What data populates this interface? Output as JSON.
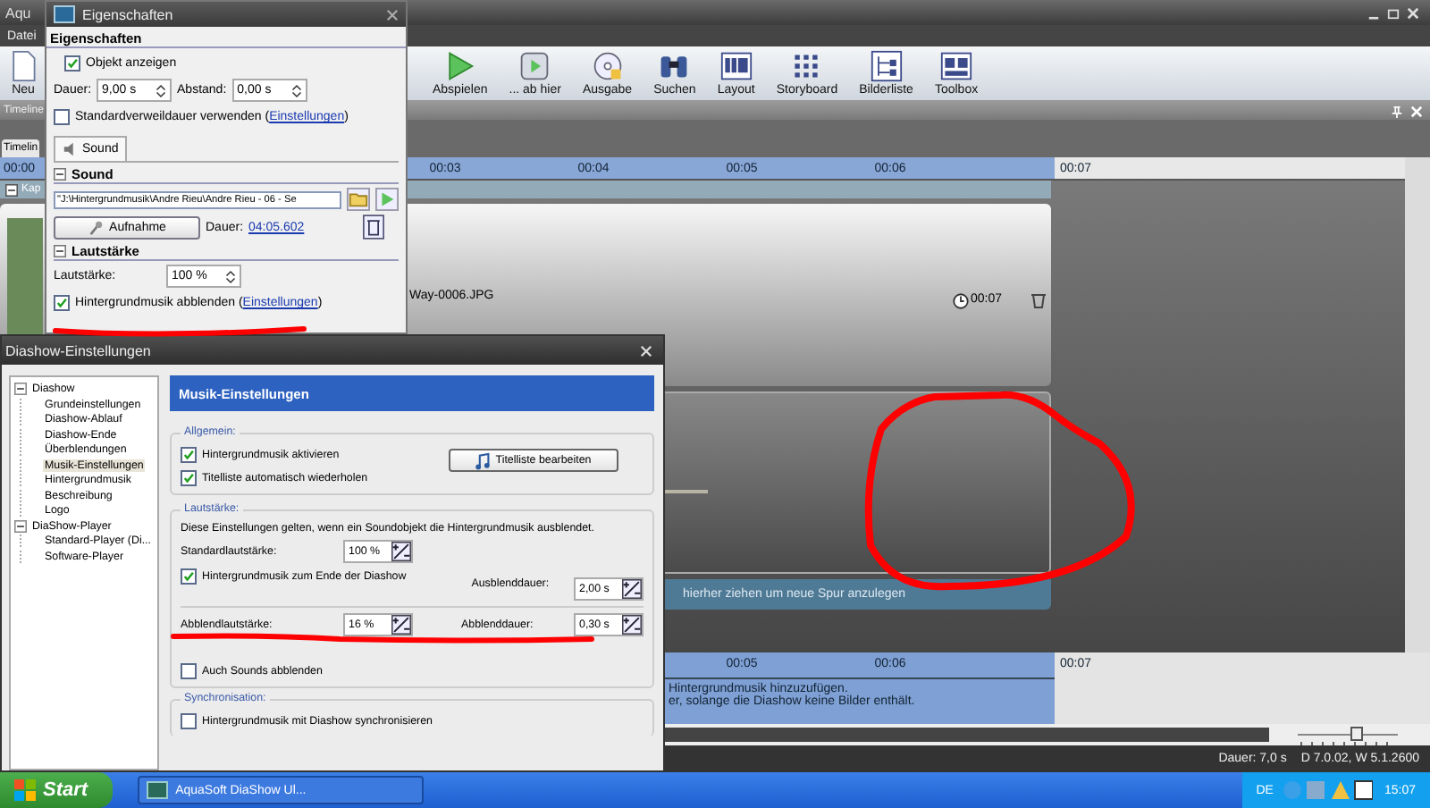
{
  "app_window": {
    "title": "Aqu",
    "menu": [
      "Datei"
    ]
  },
  "toolbar": [
    {
      "label": "Neu",
      "kind": "document"
    },
    {
      "label": "Abspielen",
      "kind": "play"
    },
    {
      "label": "... ab hier",
      "kind": "film"
    },
    {
      "label": "Ausgabe",
      "kind": "disc"
    },
    {
      "label": "Suchen",
      "kind": "binoculars"
    },
    {
      "label": "Layout",
      "kind": "layout"
    },
    {
      "label": "Storyboard",
      "kind": "grid"
    },
    {
      "label": "Bilderliste",
      "kind": "list"
    },
    {
      "label": "Toolbox",
      "kind": "toolbox"
    }
  ],
  "timeline_panel": {
    "title": "Timeline",
    "tab": "Timelin",
    "ruler": [
      "00:00",
      "00:03",
      "00:04",
      "00:05",
      "00:06",
      "00:07"
    ],
    "chapter": "Kap",
    "image_track": {
      "filename": "Way-0006.JPG",
      "duration": "00:07"
    },
    "drop_hint": "hierher ziehen um neue Spur anzulegen",
    "zoom_slider": {
      "level": 0.6
    }
  },
  "storyboard": {
    "ruler": [
      "00:05",
      "00:06",
      "00:07"
    ],
    "lines": [
      "Hintergrundmusik hinzuzufügen.",
      "er, solange die Diashow keine Bilder enthält."
    ]
  },
  "status_bar": [
    "Dauer: 7,0 s",
    "D 7.0.02, W 5.1.2600"
  ],
  "properties_window": {
    "title": "Eigenschaften",
    "heading": "Eigenschaften",
    "show_object": {
      "label": "Objekt anzeigen",
      "checked": true
    },
    "duration": {
      "label": "Dauer:",
      "value": "9,00 s"
    },
    "spacing": {
      "label": "Abstand:",
      "value": "0,00 s"
    },
    "default_duration": {
      "before": "Standardverweildauer verwenden (",
      "link": "Einstellungen",
      "after": ")",
      "checked": false
    },
    "tab": {
      "label": "Sound",
      "selected": true
    },
    "sound_group": {
      "title": "Sound",
      "file": "\"J:\\Hintergrundmusik\\Andre Rieu\\Andre Rieu - 06 - Se",
      "record": "Aufnahme",
      "duration_label": "Dauer:",
      "duration": "04:05.602"
    },
    "volume_group": {
      "title": "Lautstärke",
      "volume_label": "Lautstärke:",
      "volume": "100 %",
      "fade": {
        "before": "Hintergrundmusik abblenden (",
        "link": "Einstellungen",
        "after": ")",
        "checked": true
      }
    }
  },
  "settings_dialog": {
    "title": "Diashow-Einstellungen",
    "tree": [
      {
        "label": "Diashow",
        "expanded": true,
        "selected": false,
        "children": [
          {
            "label": "Grundeinstellungen",
            "selected": false
          },
          {
            "label": "Diashow-Ablauf",
            "selected": false
          },
          {
            "label": "Diashow-Ende",
            "selected": false
          },
          {
            "label": "Überblendungen",
            "selected": false
          },
          {
            "label": "Musik-Einstellungen",
            "selected": true
          },
          {
            "label": "Hintergrundmusik",
            "selected": false
          },
          {
            "label": "Beschreibung",
            "selected": false
          },
          {
            "label": "Logo",
            "selected": false
          }
        ]
      },
      {
        "label": "DiaShow-Player",
        "expanded": true,
        "selected": false,
        "children": [
          {
            "label": "Standard-Player (Di...",
            "selected": false
          },
          {
            "label": "Software-Player",
            "selected": false
          }
        ]
      }
    ],
    "header": "Musik-Einstellungen",
    "general": {
      "title": "Allgemein:",
      "options": [
        {
          "label": "Hintergrundmusik aktivieren",
          "checked": true
        },
        {
          "label": "Titelliste automatisch wiederholen",
          "checked": true
        }
      ],
      "button": "Titelliste bearbeiten"
    },
    "volume": {
      "title": "Lautstärke:",
      "description": "Diese Einstellungen gelten, wenn ein Soundobjekt die Hintergrundmusik ausblendet.",
      "standard_label": "Standardlautstärke:",
      "standard": "100 %",
      "fade_end": {
        "label": "Hintergrundmusik zum Ende der Diashow",
        "checked": true
      },
      "fadeout_label": "Ausblenddauer:",
      "fadeout": "2,00 s",
      "dim_label": "Abblendlautstärke:",
      "dim": "16 %",
      "dim_time_label": "Abblenddauer:",
      "dim_time": "0,30 s",
      "sounds": {
        "label": "Auch Sounds abblenden",
        "checked": false
      }
    },
    "sync": {
      "title": "Synchronisation:",
      "option": {
        "label": "Hintergrundmusik mit Diashow synchronisieren",
        "checked": false
      }
    }
  },
  "taskbar": {
    "start": "Start",
    "task": "AquaSoft DiaShow Ul...",
    "language": "DE",
    "clock": "15:07"
  }
}
